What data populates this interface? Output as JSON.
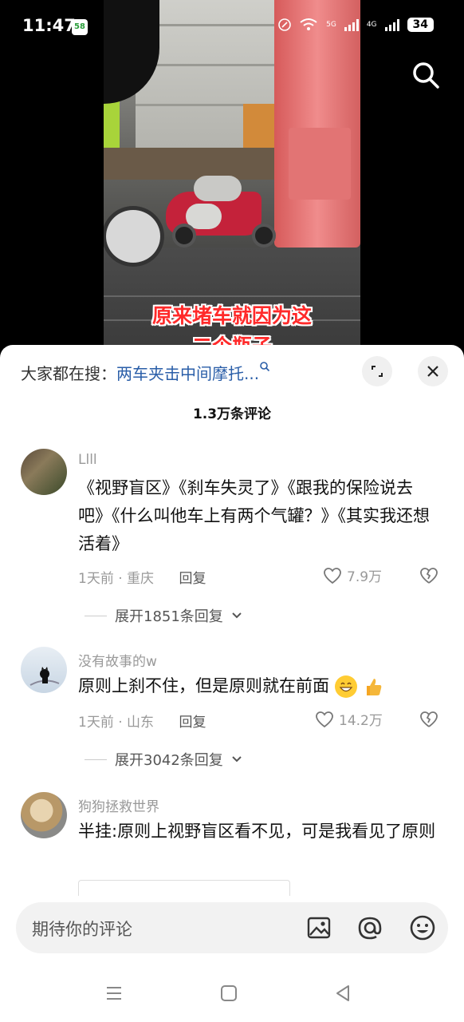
{
  "status_bar": {
    "time": "11:47",
    "app_badge": "58",
    "network_1": "5G",
    "network_2": "4G",
    "battery": "34"
  },
  "video": {
    "caption_line1": "原来堵车就因为这",
    "caption_line2": "二个瓶子"
  },
  "sheet": {
    "search_prefix": "大家都在搜：",
    "search_keyword": "两车夹击中间摩托...",
    "comment_count": "1.3万条评论"
  },
  "comments": [
    {
      "user": "Llll",
      "text": "《视野盲区》《刹车失灵了》《跟我的保险说去吧》《什么叫他车上有两个气罐？》《其实我还想活着》",
      "time": "1天前",
      "location": "重庆",
      "reply_label": "回复",
      "likes": "7.9万",
      "expand_label": "展开1851条回复"
    },
    {
      "user": "没有故事的w",
      "text": "原则上刹不住，但是原则就在前面",
      "time": "1天前",
      "location": "山东",
      "reply_label": "回复",
      "likes": "14.2万",
      "expand_label": "展开3042条回复"
    },
    {
      "user": "狗狗拯救世界",
      "text": "半挂:原则上视野盲区看不见，可是我看见了原则"
    }
  ],
  "input": {
    "placeholder": "期待你的评论"
  },
  "icons": [
    "search-icon",
    "expand-icon",
    "close-icon",
    "heart-icon",
    "broken-heart-icon",
    "chevron-down-icon",
    "image-icon",
    "at-icon",
    "emoji-icon",
    "menu-icon",
    "home-icon",
    "back-icon"
  ],
  "colors": {
    "caption_red": "#ff2a2a",
    "keyword_blue": "#2a5ea8",
    "meta_gray": "#999999"
  }
}
